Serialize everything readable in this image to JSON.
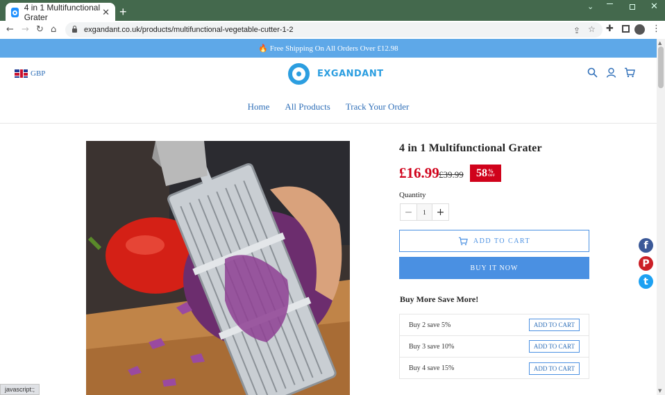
{
  "browser": {
    "tab_title": "4 in 1 Multifunctional Grater",
    "tab_close": "✕",
    "new_tab": "+",
    "url": "exgandant.co.uk/products/multifunctional-vegetable-cutter-1-2",
    "status_text": "javascript:;"
  },
  "site": {
    "announcement": "🔥 Free Shipping On All Orders Over £12.98",
    "currency": "GBP",
    "logo_text": "EXGANDANT",
    "nav": [
      "Home",
      "All Products",
      "Track Your Order"
    ]
  },
  "product": {
    "title": "4 in 1 Multifunctional Grater",
    "price": "£16.99",
    "compare_price": "£39.99",
    "discount_number": "58",
    "discount_percent": "%",
    "discount_off": "OFF",
    "quantity_label": "Quantity",
    "quantity_value": "1",
    "minus": "−",
    "plus": "+",
    "add_to_cart": "ADD TO CART",
    "buy_now": "BUY IT NOW"
  },
  "bundles": {
    "title": "Buy More Save More!",
    "offers": [
      {
        "label": "Buy 2 save 5%",
        "button": "ADD TO CART"
      },
      {
        "label": "Buy 3 save 10%",
        "button": "ADD TO CART"
      },
      {
        "label": "Buy 4 save 15%",
        "button": "ADD TO CART"
      }
    ]
  },
  "social": {
    "facebook": "f",
    "pinterest": "P",
    "twitter": "t"
  },
  "colors": {
    "accent": "#4a90e2",
    "price_red": "#d0021b",
    "chrome_green": "#44694d",
    "announcement_bar": "#5ea8e8"
  }
}
